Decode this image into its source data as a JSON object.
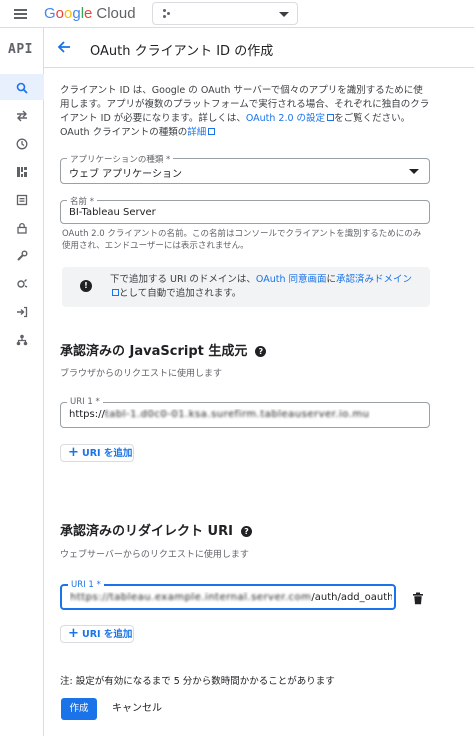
{
  "topbar": {
    "logo_google": [
      "G",
      "o",
      "o",
      "g",
      "l",
      "e"
    ],
    "logo_cloud": "Cloud"
  },
  "rail": {
    "title": "API",
    "items": [
      "search-icon",
      "sync-icon",
      "history-icon",
      "dashboard-icon",
      "library-icon",
      "lock-icon",
      "wrench-icon",
      "settings-icon",
      "login-icon",
      "hierarchy-icon"
    ]
  },
  "header": {
    "title": "OAuth クライアント ID の作成"
  },
  "intro": {
    "text": "クライアント ID は、Google の OAuth サーバーで個々のアプリを識別するために使用します。アプリが複数のプラットフォームで実行される場合、それぞれに独自のクライアント ID が必要になります。詳しくは、",
    "link1": "OAuth 2.0 の設定",
    "text2": "をご覧ください。OAuth クライアントの種類の",
    "link2": "詳細"
  },
  "app_type": {
    "label": "アプリケーションの種類 *",
    "value": "ウェブ アプリケーション"
  },
  "name_field": {
    "label": "名前 *",
    "value": "BI-Tableau Server",
    "help": "OAuth 2.0 クライアントの名前。この名前はコンソールでクライアントを識別するためにのみ使用され、エンドユーザーには表示されません。"
  },
  "info": {
    "text1": "下で追加する URI のドメインは、",
    "link1": "OAuth 同意画面",
    "text2": "に",
    "link2": "承認済みドメイン",
    "text3": "として自動で追加されます。"
  },
  "js_origins": {
    "title": "承認済みの JavaScript 生成元",
    "subtitle": "ブラウザからのリクエストに使用します",
    "uri_label": "URI 1 *",
    "uri_value": "https://",
    "uri_blurred": "tabl-1.d0c0-01.ksa.surefirm.tableauserver.io.mu",
    "add_label": "URI を追加"
  },
  "redirect": {
    "title": "承認済みのリダイレクト URI",
    "subtitle": "ウェブサーバーからのリクエストに使用します",
    "uri_label": "URI 1 *",
    "uri_blurred": "https://tableau.example.internal.server.com",
    "uri_value": "/auth/add_oauth_token",
    "add_label": "URI を追加"
  },
  "note": "注: 設定が有効になるまで 5 分から数時間かかることがあります",
  "actions": {
    "create": "作成",
    "cancel": "キャンセル"
  },
  "colors": {
    "primary": "#1a73e8",
    "info_bg": "#f1f3f4",
    "border": "#dadce0"
  }
}
